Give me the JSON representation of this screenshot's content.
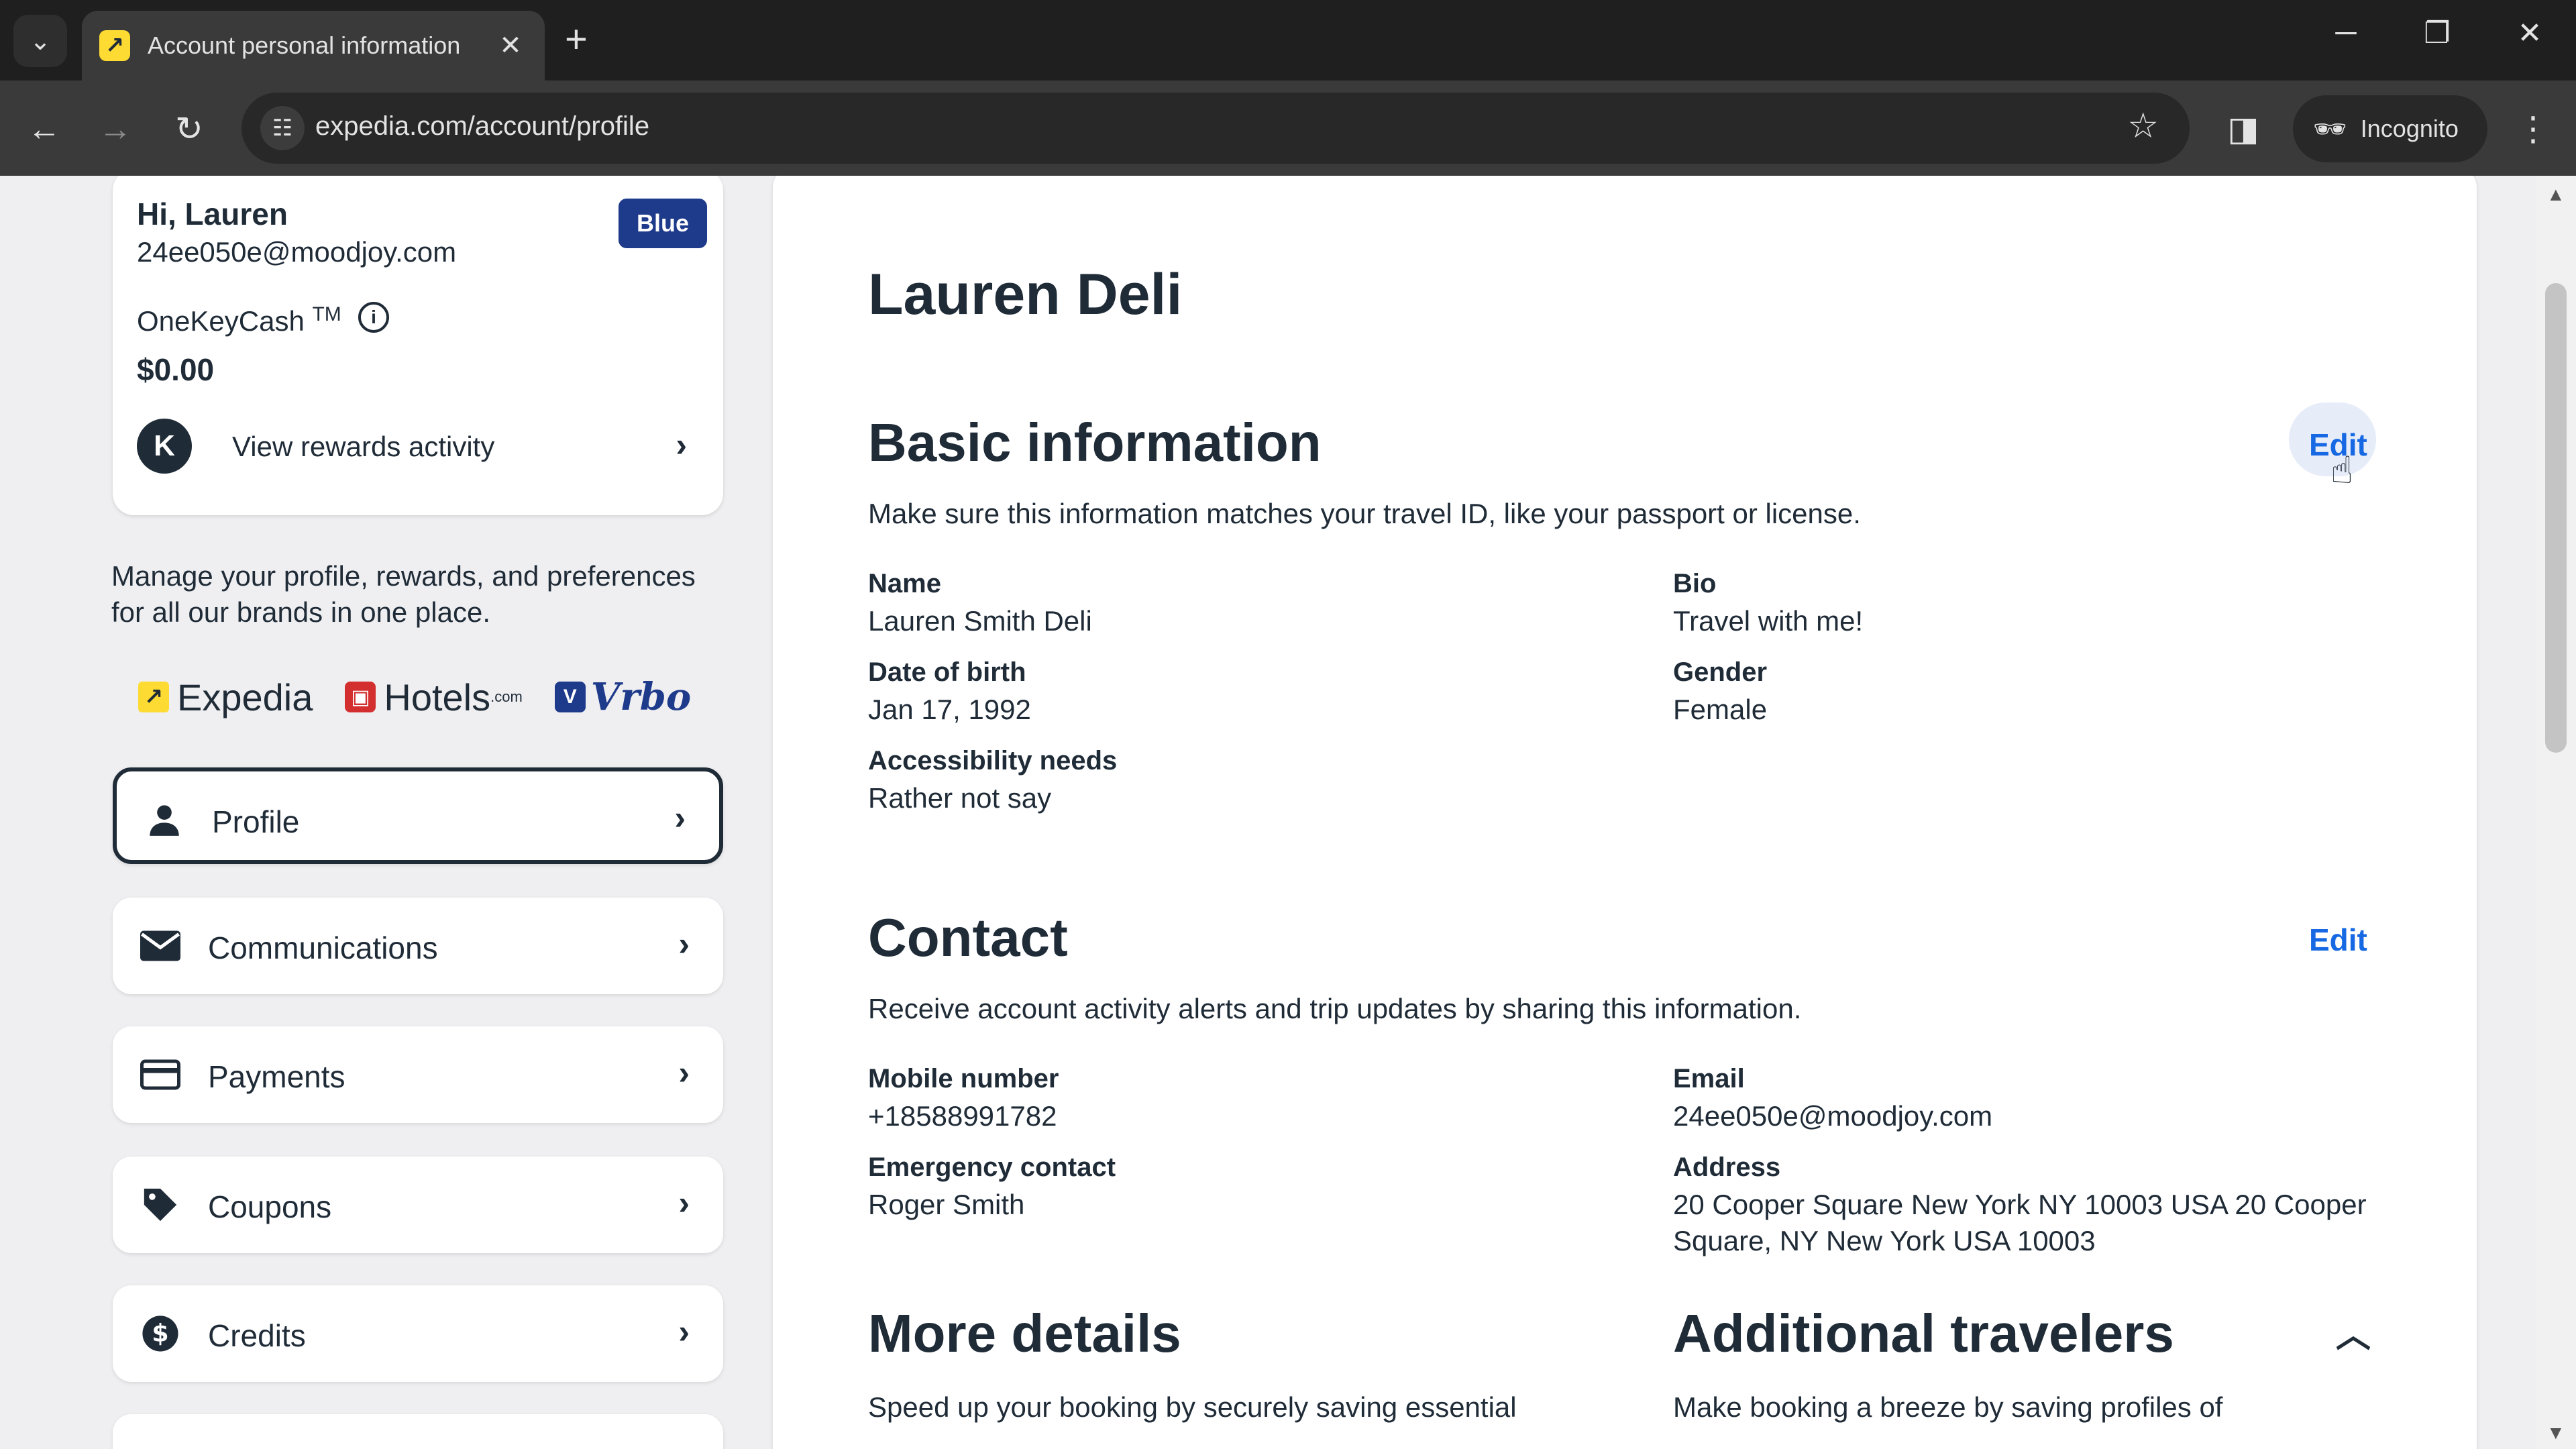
{
  "browser": {
    "tab_title": "Account personal information",
    "url": "expedia.com/account/profile",
    "incognito_label": "Incognito"
  },
  "user": {
    "greeting": "Hi, Lauren",
    "email": "24ee050e@moodjoy.com",
    "tier": "Blue",
    "onekeycash_label": "OneKeyCash",
    "onekeycash_tm": "TM",
    "onekeycash_value": "$0.00",
    "rewards_link": "View rewards activity"
  },
  "sidebar": {
    "manage_text": "Manage your profile, rewards, and preferences for all our brands in one place.",
    "brands": {
      "expedia": "Expedia",
      "hotels": "Hotels",
      "hotels_suffix": ".com",
      "vrbo": "Vrbo"
    },
    "items": [
      {
        "label": "Profile",
        "icon": "person-icon"
      },
      {
        "label": "Communications",
        "icon": "mail-icon"
      },
      {
        "label": "Payments",
        "icon": "card-icon"
      },
      {
        "label": "Coupons",
        "icon": "tag-icon"
      },
      {
        "label": "Credits",
        "icon": "dollar-icon"
      }
    ]
  },
  "profile": {
    "name_heading": "Lauren Deli",
    "basic": {
      "title": "Basic information",
      "edit": "Edit",
      "desc": "Make sure this information matches your travel ID, like your passport or license.",
      "name_label": "Name",
      "name_value": "Lauren Smith Deli",
      "bio_label": "Bio",
      "bio_value": "Travel with me!",
      "dob_label": "Date of birth",
      "dob_value": "Jan 17, 1992",
      "gender_label": "Gender",
      "gender_value": "Female",
      "access_label": "Accessibility needs",
      "access_value": "Rather not say"
    },
    "contact": {
      "title": "Contact",
      "edit": "Edit",
      "desc": "Receive account activity alerts and trip updates by sharing this information.",
      "mobile_label": "Mobile number",
      "mobile_value": "+18588991782",
      "email_label": "Email",
      "email_value": "24ee050e@moodjoy.com",
      "emergency_label": "Emergency contact",
      "emergency_value": "Roger Smith",
      "address_label": "Address",
      "address_line1": "20 Cooper Square New York NY 10003 USA 20 Cooper",
      "address_line2": "Square, NY New York USA 10003"
    },
    "more": {
      "title": "More details",
      "desc": "Speed up your booking by securely saving essential"
    },
    "travelers": {
      "title": "Additional travelers",
      "desc": "Make booking a breeze by saving profiles of"
    }
  }
}
